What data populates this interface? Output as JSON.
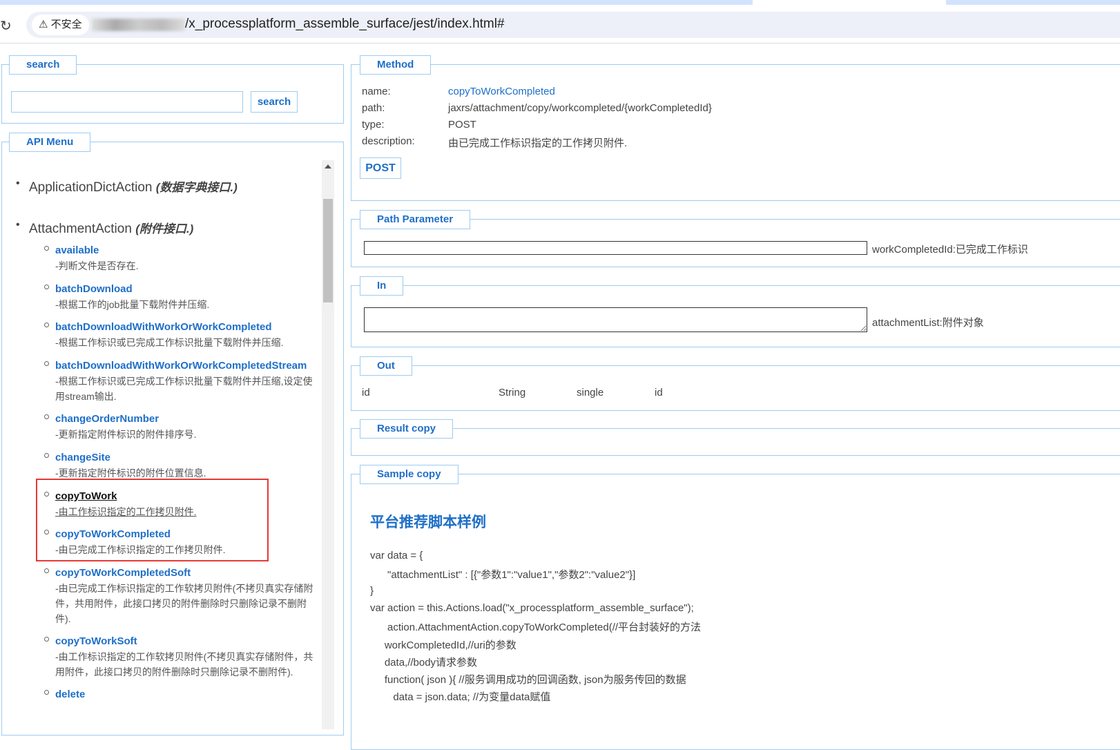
{
  "browser": {
    "security": "不安全",
    "url": "/x_processplatform_assemble_surface/jest/index.html#"
  },
  "search": {
    "legend": "search",
    "placeholder": "",
    "button": "search"
  },
  "menu": {
    "legend": "API Menu",
    "groups": [
      {
        "name": "ApplicationDictAction",
        "desc": "(数据字典接口.)"
      },
      {
        "name": "AttachmentAction",
        "desc": "(附件接口.)"
      }
    ],
    "items": [
      {
        "name": "available",
        "desc": "-判断文件是否存在."
      },
      {
        "name": "batchDownload",
        "desc": "-根据工作的job批量下载附件并压缩."
      },
      {
        "name": "batchDownloadWithWorkOrWorkCompleted",
        "desc": "-根据工作标识或已完成工作标识批量下载附件并压缩."
      },
      {
        "name": "batchDownloadWithWorkOrWorkCompletedStream",
        "desc": "-根据工作标识或已完成工作标识批量下载附件并压缩,设定使用stream输出."
      },
      {
        "name": "changeOrderNumber",
        "desc": "-更新指定附件标识的附件排序号."
      },
      {
        "name": "changeSite",
        "desc": "-更新指定附件标识的附件位置信息."
      },
      {
        "name": "copyToWork",
        "desc": "-由工作标识指定的工作拷贝附件."
      },
      {
        "name": "copyToWorkCompleted",
        "desc": "-由已完成工作标识指定的工作拷贝附件."
      },
      {
        "name": "copyToWorkCompletedSoft",
        "desc": "-由已完成工作标识指定的工作软拷贝附件(不拷贝真实存储附件，共用附件，此接口拷贝的附件删除时只删除记录不删附件)."
      },
      {
        "name": "copyToWorkSoft",
        "desc": "-由工作标识指定的工作软拷贝附件(不拷贝真实存储附件，共用附件，此接口拷贝的附件删除时只删除记录不删附件)."
      },
      {
        "name": "delete",
        "desc": ""
      }
    ]
  },
  "method": {
    "legend": "Method",
    "name_label": "name:",
    "name": "copyToWorkCompleted",
    "path_label": "path:",
    "path": "jaxrs/attachment/copy/workcompleted/{workCompletedId}",
    "type_label": "type:",
    "type": "POST",
    "desc_label": "description:",
    "desc": "由已完成工作标识指定的工作拷贝附件.",
    "button": "POST"
  },
  "path_param": {
    "legend": "Path Parameter",
    "value": "",
    "label": "workCompletedId:已完成工作标识"
  },
  "in": {
    "legend": "In",
    "value": "",
    "label": "attachmentList:附件对象"
  },
  "out": {
    "legend": "Out",
    "cols": [
      "id",
      "String",
      "single",
      "id"
    ]
  },
  "result": {
    "legend": "Result copy"
  },
  "sample": {
    "legend": "Sample copy",
    "title": "平台推荐脚本样例",
    "lines": [
      "var data = {",
      "      \"attachmentList\" : [{\"参数1\":\"value1\",\"参数2\":\"value2\"}]",
      "}",
      "var action = this.Actions.load(\"x_processplatform_assemble_surface\");",
      "      action.AttachmentAction.copyToWorkCompleted(//平台封装好的方法",
      "     workCompletedId,//uri的参数",
      "     data,//body请求参数",
      "     function( json ){ //服务调用成功的回调函数, json为服务传回的数据",
      "        data = json.data; //为变量data赋值"
    ]
  },
  "highlight_color": "#e53935"
}
